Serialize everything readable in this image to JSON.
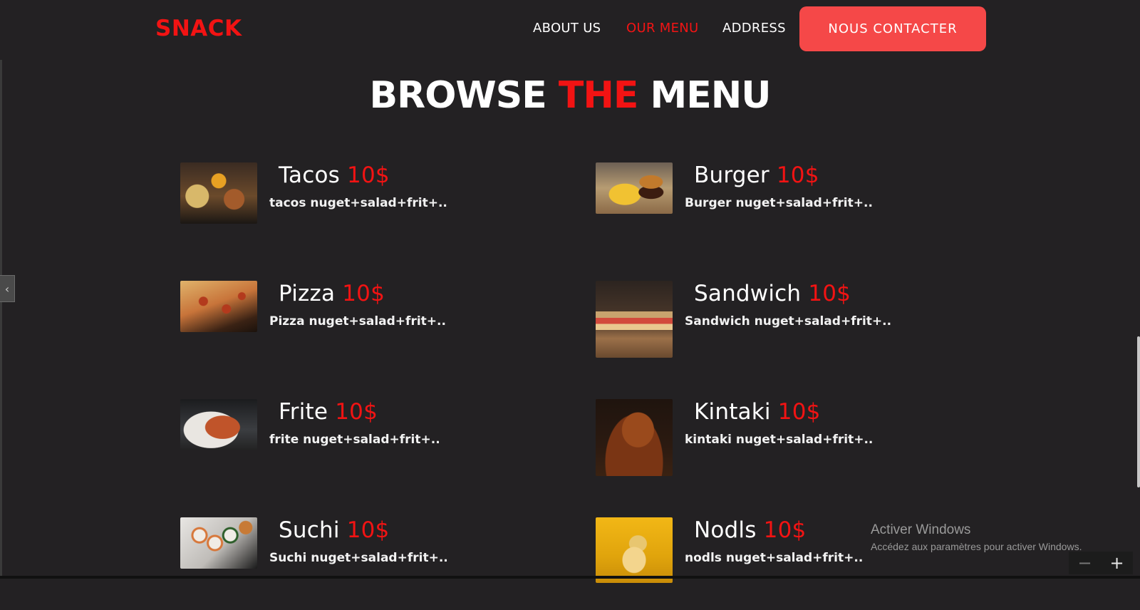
{
  "header": {
    "logo": "SNACK",
    "nav": [
      "ABOUT US",
      "OUR MENU",
      "ADDRESS"
    ],
    "contact_button": "NOUS CONTACTER"
  },
  "title": {
    "part1": "BROWSE",
    "part2": "THE",
    "part3": "MENU"
  },
  "menu": [
    {
      "name": "Tacos",
      "price": "10$",
      "desc": "tacos nuget+salad+frit+.."
    },
    {
      "name": "Burger",
      "price": "10$",
      "desc": "Burger nuget+salad+frit+.."
    },
    {
      "name": "Pizza",
      "price": "10$",
      "desc": "Pizza nuget+salad+frit+.."
    },
    {
      "name": "Sandwich",
      "price": "10$",
      "desc": "Sandwich nuget+salad+frit+.."
    },
    {
      "name": "Frite",
      "price": "10$",
      "desc": "frite nuget+salad+frit+.."
    },
    {
      "name": "Kintaki",
      "price": "10$",
      "desc": "kintaki nuget+salad+frit+.."
    },
    {
      "name": "Suchi",
      "price": "10$",
      "desc": "Suchi nuget+salad+frit+.."
    },
    {
      "name": "Nodls",
      "price": "10$",
      "desc": "nodls nuget+salad+frit+.."
    }
  ],
  "watermark": {
    "title": "Activer Windows",
    "subtitle": "Accédez aux paramètres pour activer Windows."
  },
  "icons": {
    "side_tab": "chevron-left-icon",
    "zoom_out": "minus-icon",
    "zoom_in": "plus-icon"
  },
  "colors": {
    "background": "#232123",
    "accent": "#f21313",
    "button": "#f54848"
  }
}
